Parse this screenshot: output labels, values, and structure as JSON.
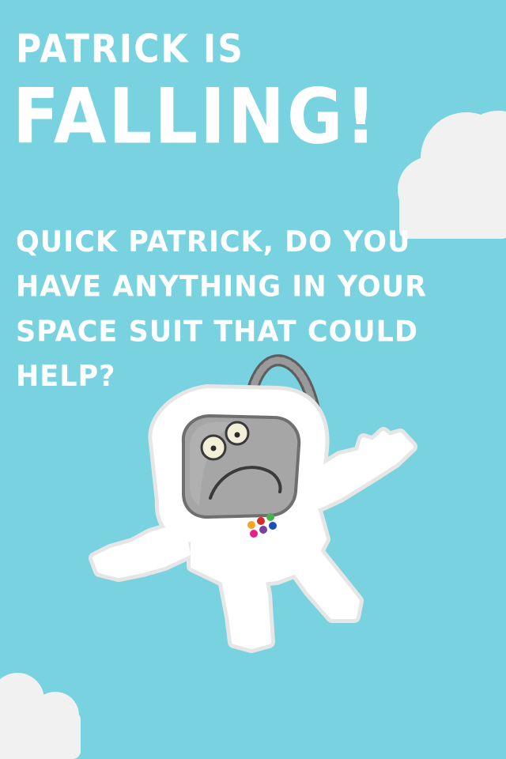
{
  "screen": {
    "background_color": "#78d2df",
    "cloud_color": "#f1f1f1"
  },
  "title": {
    "line1": "PATRICK IS",
    "line2": "FALLING!"
  },
  "prompt": {
    "lines": [
      "QUICK PATRICK, DO YOU",
      "HAVE ANYTHING IN YOUR",
      "SPACE SUIT THAT COULD",
      "HELP?"
    ]
  },
  "character": {
    "name_hidden": "",
    "suit_color": "#ffffff",
    "visor_color": "#a6a6a6",
    "hose_color": "#8a8a8a",
    "chest_buttons": [
      "#f6a623",
      "#d72a2a",
      "#4caf50",
      "#e91e8c",
      "#7b3fa0",
      "#1e4fb5"
    ]
  }
}
